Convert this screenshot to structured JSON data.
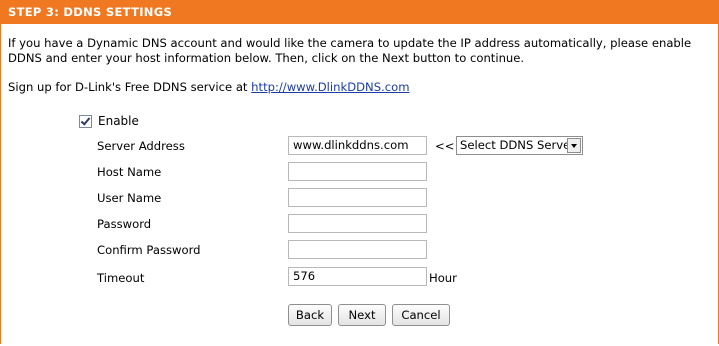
{
  "header": {
    "title": "STEP 3: DDNS SETTINGS"
  },
  "intro": {
    "text": "If you have a Dynamic DNS account and would like the camera to update the IP address automatically, please enable DDNS and enter your host information below. Then, click on the Next button to continue."
  },
  "signup": {
    "text": "Sign up for D-Link's Free DDNS service at",
    "link": "http://www.DlinkDDNS.com"
  },
  "form": {
    "enable_label": "Enable",
    "enable_checked": true,
    "server_address_label": "Server Address",
    "server_address_value": "www.dlinkddns.com",
    "server_arrows": "<<",
    "ddns_server_select": "Select DDNS Server",
    "host_name_label": "Host Name",
    "host_name_value": "",
    "user_name_label": "User Name",
    "user_name_value": "",
    "password_label": "Password",
    "password_value": "",
    "confirm_password_label": "Confirm Password",
    "confirm_password_value": "",
    "timeout_label": "Timeout",
    "timeout_value": "576",
    "timeout_unit": "Hour"
  },
  "buttons": {
    "back": "Back",
    "next": "Next",
    "cancel": "Cancel"
  },
  "colors": {
    "header_bg": "#f07820",
    "link": "#1a3ca8"
  }
}
